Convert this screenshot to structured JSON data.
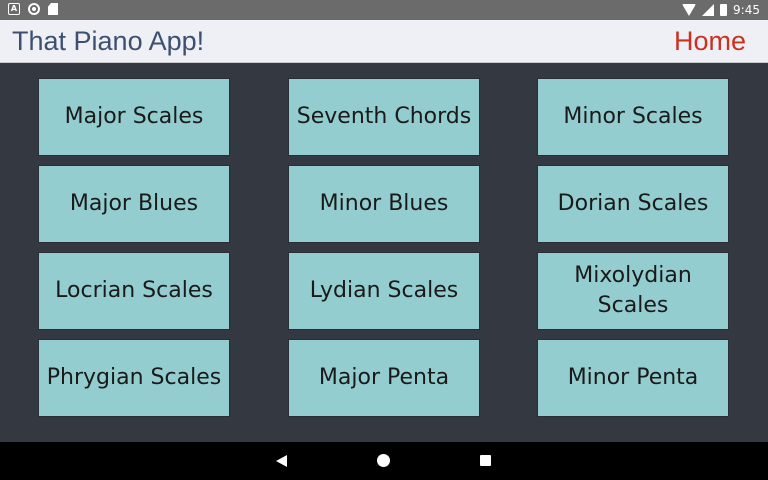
{
  "status_bar": {
    "time": "9:45",
    "icons": [
      "notification-a-icon",
      "sync-icon",
      "sd-card-icon",
      "wifi-icon",
      "signal-icon",
      "battery-icon"
    ]
  },
  "app_bar": {
    "title": "That Piano App!",
    "home_label": "Home",
    "colors": {
      "title": "#3d5070",
      "home": "#c8321e",
      "background": "#efeff6"
    }
  },
  "grid": {
    "background": "#343841",
    "tile_color": "#93cdcf",
    "items": [
      {
        "label": "Major Scales"
      },
      {
        "label": "Seventh Chords"
      },
      {
        "label": "Minor Scales"
      },
      {
        "label": "Major Blues"
      },
      {
        "label": "Minor Blues"
      },
      {
        "label": "Dorian Scales"
      },
      {
        "label": "Locrian Scales"
      },
      {
        "label": "Lydian Scales"
      },
      {
        "label": "Mixolydian Scales"
      },
      {
        "label": "Phrygian Scales"
      },
      {
        "label": "Major Penta"
      },
      {
        "label": "Minor Penta"
      }
    ]
  },
  "nav_bar": {
    "icons": [
      "back-icon",
      "home-icon",
      "recents-icon"
    ]
  }
}
